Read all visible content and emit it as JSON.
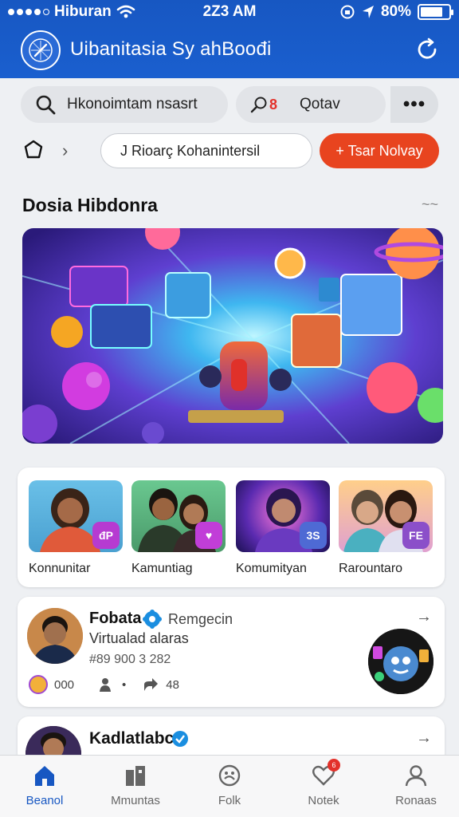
{
  "status_bar": {
    "carrier": "Hiburan",
    "time": "2Z3 AM",
    "battery": "80%",
    "battery_level": 0.8
  },
  "header": {
    "title": "Uibanitasia Sy ahBoođi",
    "logo_icon": "compass-icon",
    "refresh_icon": "refresh-icon"
  },
  "search": {
    "placeholder": "Hkonoimtam nsasrt",
    "filter_label": "Qotav",
    "filter_badge": "8",
    "more_label": "•••"
  },
  "community_search": {
    "placeholder": "J  Rioarç Kohanintersil",
    "cta_label": "+ Tsar Nolvay"
  },
  "section": {
    "title": "Dosia Hibdonra",
    "more": "~~"
  },
  "communities": [
    {
      "label": "Konnunitar",
      "badge": "đP",
      "badge_color": "#b63bd1"
    },
    {
      "label": "Kamuntiag",
      "badge": "♥",
      "badge_color": "#c13ed8"
    },
    {
      "label": "Komumityan",
      "badge": "3S",
      "badge_color": "#4e6ad4"
    },
    {
      "label": "Rarountaro",
      "badge": "FE",
      "badge_color": "#8b4fc9"
    }
  ],
  "posts": [
    {
      "name": "Fobata",
      "tag": "Remgecin",
      "subtitle": "Virtualad alaras",
      "meta": "#89 900 3 282",
      "stat1": "000",
      "stat2": "•",
      "stat3": "48"
    },
    {
      "name": "Kadlatlabc"
    }
  ],
  "tabbar": [
    {
      "label": "Beanol",
      "icon": "home-icon",
      "active": true
    },
    {
      "label": "Mmuntas",
      "icon": "community-icon"
    },
    {
      "label": "Folk",
      "icon": "emoji-icon"
    },
    {
      "label": "Notek",
      "icon": "heart-icon",
      "badge": "6"
    },
    {
      "label": "Ronaas",
      "icon": "profile-icon"
    }
  ],
  "colors": {
    "header_blue": "#1757c2",
    "cta_orange": "#e8441f",
    "badge_red": "#e3312a"
  }
}
